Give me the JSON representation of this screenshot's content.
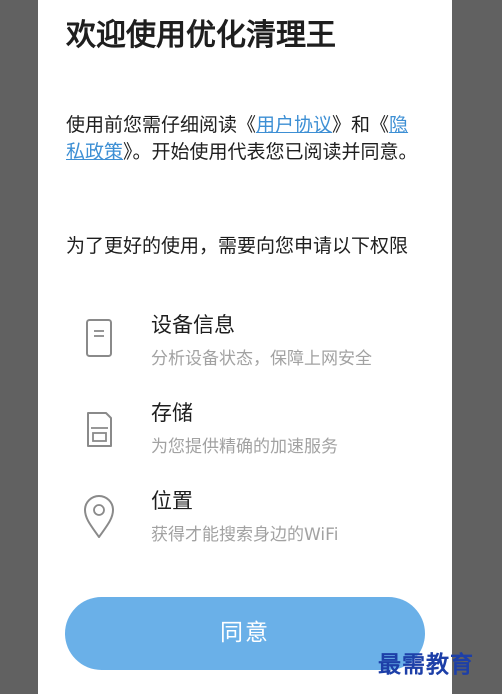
{
  "dialog": {
    "title": "欢迎使用优化清理王",
    "intro": {
      "part1": "使用前您需仔细阅读《",
      "user_agreement_link": "用户协议",
      "part2": "》和《",
      "privacy_policy_link": "隐私政策",
      "part3": "》。开始使用代表您已阅读并同意。"
    },
    "permissions_heading": "为了更好的使用，需要向您申请以下权限",
    "permissions": [
      {
        "icon": "phone-device-icon",
        "title": "设备信息",
        "description": "分析设备状态，保障上网安全"
      },
      {
        "icon": "sd-card-storage-icon",
        "title": "存储",
        "description": "为您提供精确的加速服务"
      },
      {
        "icon": "location-pin-icon",
        "title": "位置",
        "description": "获得才能搜索身边的WiFi"
      }
    ],
    "agree_button": "同意"
  },
  "watermark": "最需教育",
  "colors": {
    "backdrop": "#616161",
    "dialog_bg": "#ffffff",
    "link": "#3d8fd4",
    "button": "#6ab0e8",
    "desc_text": "#a2a2a2",
    "watermark": "#1d3fa8"
  }
}
